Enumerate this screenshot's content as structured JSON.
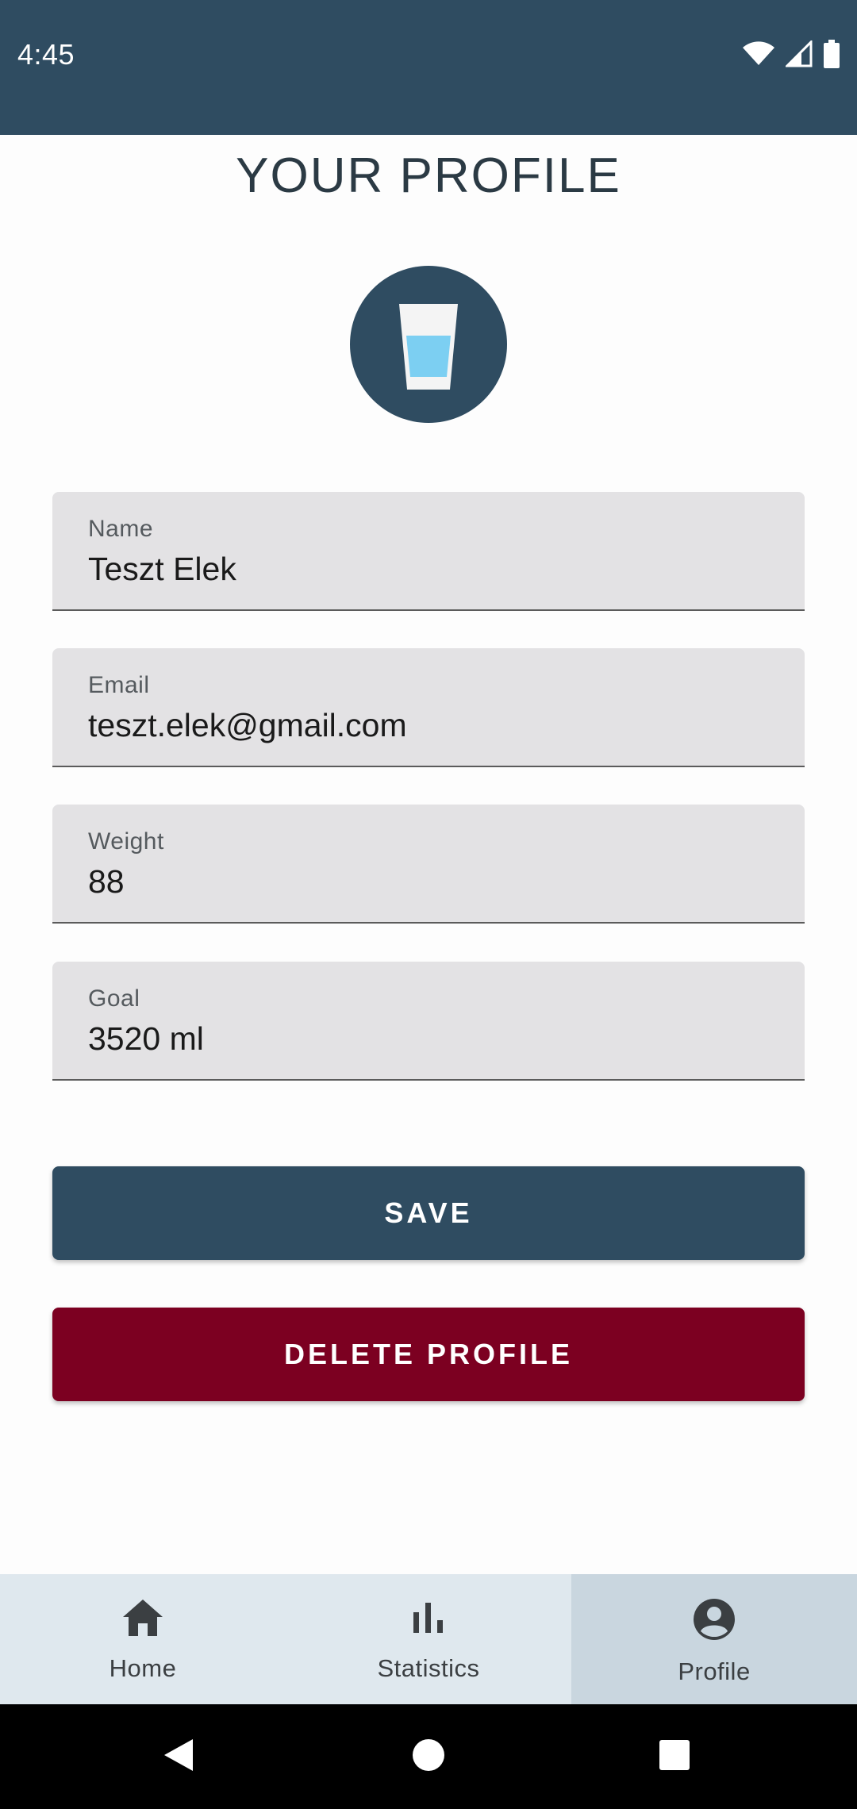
{
  "status_bar": {
    "time": "4:45",
    "icons": [
      "wifi-icon",
      "signal-icon",
      "battery-icon"
    ]
  },
  "page": {
    "title": "YOUR PROFILE",
    "avatar_icon": "water-glass-icon"
  },
  "form": {
    "name": {
      "label": "Name",
      "value": "Teszt Elek"
    },
    "email": {
      "label": "Email",
      "value": "teszt.elek@gmail.com"
    },
    "weight": {
      "label": "Weight",
      "value": "88"
    },
    "goal": {
      "label": "Goal",
      "value": "3520 ml"
    }
  },
  "buttons": {
    "save_label": "SAVE",
    "delete_label": "DELETE PROFILE"
  },
  "bottom_nav": {
    "items": [
      {
        "label": "Home",
        "icon": "home-icon"
      },
      {
        "label": "Statistics",
        "icon": "bar-chart-icon"
      },
      {
        "label": "Profile",
        "icon": "account-circle-icon"
      }
    ],
    "active": "Profile"
  },
  "colors": {
    "primary": "#2f4c61",
    "danger": "#7c0021",
    "field_bg": "#e3e2e4",
    "nav_bg": "#dfe8ee",
    "nav_active_bg": "#c9d6df",
    "water": "#7ccff2"
  },
  "system_nav": [
    "back-icon",
    "home-circle-icon",
    "recents-icon"
  ]
}
